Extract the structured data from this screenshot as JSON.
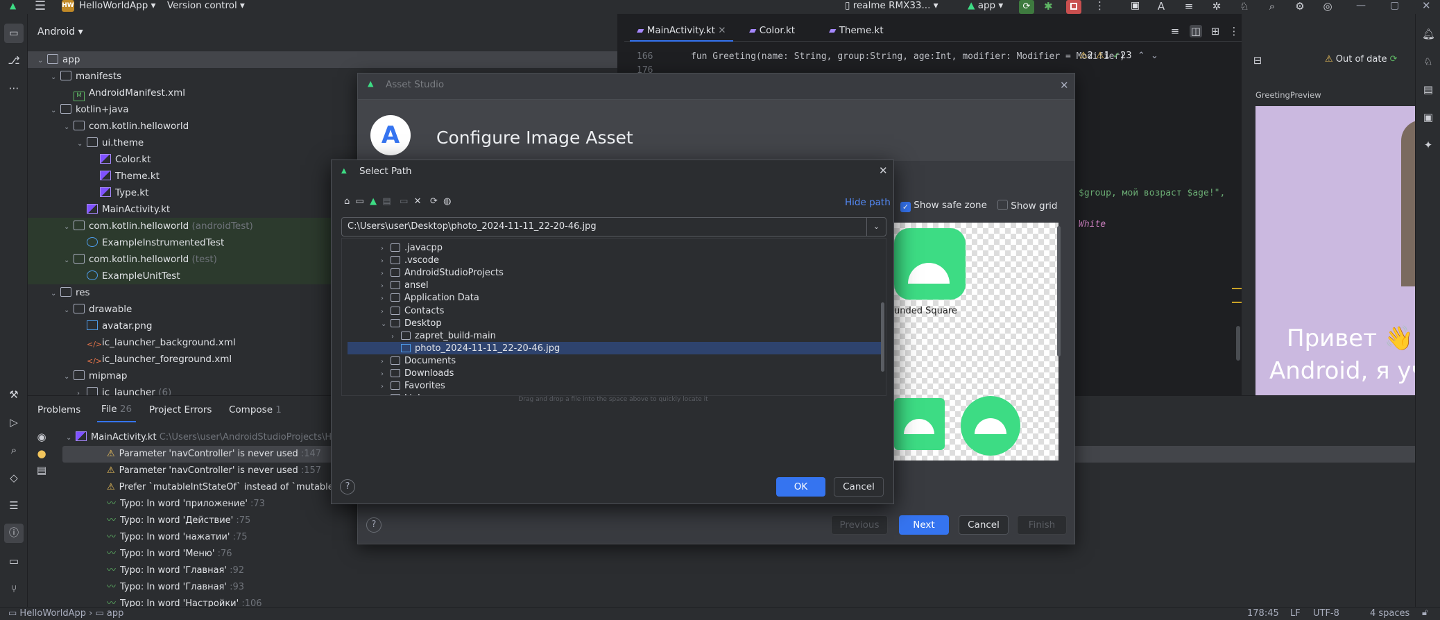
{
  "titlebar": {
    "project_badge": "HW",
    "project": "HelloWorldApp",
    "vcs": "Version control",
    "device": "realme RMX33...",
    "run_config": "app"
  },
  "project_view": {
    "selector": "Android",
    "rows": [
      {
        "label": "app",
        "indent": 0,
        "icon": "folder",
        "chev": "v",
        "sel": true
      },
      {
        "label": "manifests",
        "indent": 1,
        "icon": "folder",
        "chev": "v"
      },
      {
        "label": "AndroidManifest.xml",
        "indent": 2,
        "icon": "mf",
        "chev": ""
      },
      {
        "label": "kotlin+java",
        "indent": 1,
        "icon": "folder",
        "chev": "v"
      },
      {
        "label": "com.kotlin.helloworld",
        "indent": 2,
        "icon": "folder",
        "chev": "v"
      },
      {
        "label": "ui.theme",
        "indent": 3,
        "icon": "folder",
        "chev": "v"
      },
      {
        "label": "Color.kt",
        "indent": 4,
        "icon": "kt",
        "chev": ""
      },
      {
        "label": "Theme.kt",
        "indent": 4,
        "icon": "kt",
        "chev": ""
      },
      {
        "label": "Type.kt",
        "indent": 4,
        "icon": "kt",
        "chev": ""
      },
      {
        "label": "MainActivity.kt",
        "indent": 3,
        "icon": "kt",
        "chev": ""
      },
      {
        "label": "com.kotlin.helloworld",
        "suffix": " (androidTest)",
        "indent": 2,
        "icon": "folder",
        "chev": "v",
        "green": true
      },
      {
        "label": "ExampleInstrumentedTest",
        "indent": 3,
        "icon": "test",
        "chev": "",
        "green": true
      },
      {
        "label": "com.kotlin.helloworld",
        "suffix": " (test)",
        "indent": 2,
        "icon": "folder",
        "chev": "v",
        "green": true
      },
      {
        "label": "ExampleUnitTest",
        "indent": 3,
        "icon": "test",
        "chev": "",
        "green": true
      },
      {
        "label": "res",
        "indent": 1,
        "icon": "folder",
        "chev": "v"
      },
      {
        "label": "drawable",
        "indent": 2,
        "icon": "folder",
        "chev": "v"
      },
      {
        "label": "avatar.png",
        "indent": 3,
        "icon": "png",
        "chev": ""
      },
      {
        "label": "ic_launcher_background.xml",
        "indent": 3,
        "icon": "xml",
        "chev": ""
      },
      {
        "label": "ic_launcher_foreground.xml",
        "indent": 3,
        "icon": "xml",
        "chev": ""
      },
      {
        "label": "mipmap",
        "indent": 2,
        "icon": "folder",
        "chev": "v"
      },
      {
        "label": "ic_launcher",
        "suffix": " (6)",
        "indent": 3,
        "icon": "folder",
        "chev": ">"
      }
    ]
  },
  "editor": {
    "tabs": [
      "MainActivity.kt",
      "Color.kt",
      "Theme.kt"
    ],
    "line_166": "166",
    "line_176": "176",
    "code_line": "fun Greeting(name: String, group:String, age:Int,  modifier: Modifier = Modifier)",
    "inspect_warn": "2",
    "inspect_weak": "1",
    "inspect_ok": "23",
    "code_fragment_1": "$group, мой возраст $age!\",",
    "code_fragment_2": "White"
  },
  "preview": {
    "status": "Out of date",
    "name": "GreetingPreview",
    "text_line1": "Привет 👋",
    "text_line2": "Android, я уч"
  },
  "asset_studio": {
    "title": "Asset Studio",
    "heading": "Configure Image Asset",
    "show_safe_zone": "Show safe zone",
    "show_grid": "Show grid",
    "rounded_label": "unded Square",
    "btn_previous": "Previous",
    "btn_next": "Next",
    "btn_cancel": "Cancel",
    "btn_finish": "Finish"
  },
  "select_path": {
    "title": "Select Path",
    "hide_path": "Hide path",
    "path": "C:\\Users\\user\\Desktop\\photo_2024-11-11_22-20-46.jpg",
    "tree": [
      {
        "label": ".javacpp",
        "indent": 0,
        "chev": ">"
      },
      {
        "label": ".vscode",
        "indent": 0,
        "chev": ">"
      },
      {
        "label": "AndroidStudioProjects",
        "indent": 0,
        "chev": ">"
      },
      {
        "label": "ansel",
        "indent": 0,
        "chev": ">"
      },
      {
        "label": "Application Data",
        "indent": 0,
        "chev": ">"
      },
      {
        "label": "Contacts",
        "indent": 0,
        "chev": ">"
      },
      {
        "label": "Desktop",
        "indent": 0,
        "chev": "v"
      },
      {
        "label": "zapret_build-main",
        "indent": 1,
        "chev": ">"
      },
      {
        "label": "photo_2024-11-11_22-20-46.jpg",
        "indent": 1,
        "chev": "",
        "sel": true,
        "file": true
      },
      {
        "label": "Documents",
        "indent": 0,
        "chev": ">"
      },
      {
        "label": "Downloads",
        "indent": 0,
        "chev": ">"
      },
      {
        "label": "Favorites",
        "indent": 0,
        "chev": ">"
      },
      {
        "label": "Links",
        "indent": 0,
        "chev": ">"
      }
    ],
    "drag_hint": "Drag and drop a file into the space above to quickly locate it",
    "btn_ok": "OK",
    "btn_cancel": "Cancel"
  },
  "problems": {
    "tabs": [
      {
        "label": "Problems"
      },
      {
        "label": "File",
        "count": "26"
      },
      {
        "label": "Project Errors"
      },
      {
        "label": "Compose",
        "count": "1"
      }
    ],
    "file_header": "MainActivity.kt",
    "file_path": "C:\\Users\\user\\AndroidStudioProjects\\Hell",
    "rows": [
      {
        "text": "Parameter 'navController' is never used",
        "line": ":147",
        "kind": "warn",
        "sel": true
      },
      {
        "text": "Parameter 'navController' is never used",
        "line": ":157",
        "kind": "warn"
      },
      {
        "text": "Prefer `mutableIntStateOf` instead of `mutableStateOf",
        "line": "",
        "kind": "warn"
      },
      {
        "text": "Typo: In word 'приложение'",
        "line": ":73",
        "kind": "typo"
      },
      {
        "text": "Typo: In word 'Действие'",
        "line": ":75",
        "kind": "typo"
      },
      {
        "text": "Typo: In word 'нажатии'",
        "line": ":75",
        "kind": "typo"
      },
      {
        "text": "Typo: In word 'Меню'",
        "line": ":76",
        "kind": "typo"
      },
      {
        "text": "Typo: In word 'Главная'",
        "line": ":92",
        "kind": "typo"
      },
      {
        "text": "Typo: In word 'Главная'",
        "line": ":93",
        "kind": "typo"
      },
      {
        "text": "Typo: In word 'Настройки'",
        "line": ":106",
        "kind": "typo"
      }
    ]
  },
  "status": {
    "crumb_project": "HelloWorldApp",
    "crumb_module": "app",
    "position": "178:45",
    "line_sep": "LF",
    "encoding": "UTF-8",
    "indent": "4 spaces"
  },
  "colors": {
    "accent": "#3574f0",
    "android_green": "#3ddc84",
    "warn": "#f2c55c"
  }
}
